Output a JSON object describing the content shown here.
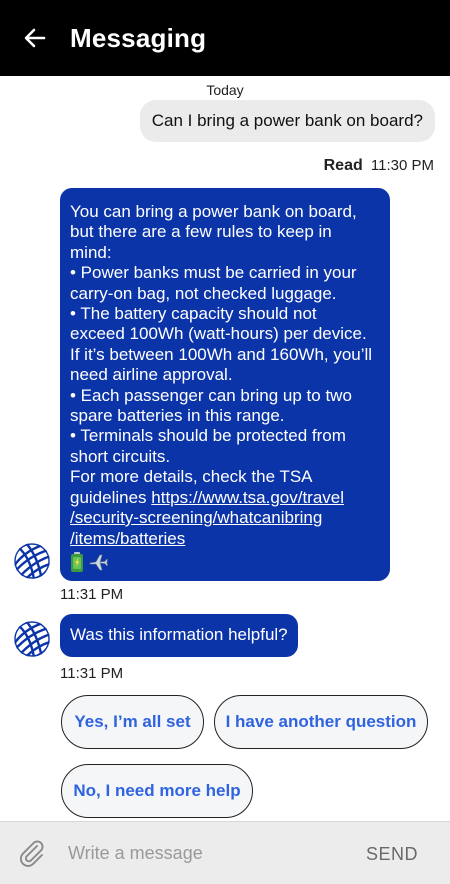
{
  "header": {
    "title": "Messaging",
    "back_icon": "arrow-left-icon"
  },
  "conversation": {
    "date_label": "Today",
    "user_message": "Can I bring a power bank on board?",
    "read_status": "Read",
    "read_time": "11:30 PM",
    "bot_answer": {
      "lines": [
        "You can bring a power bank on board,",
        "but there are a few rules to keep in",
        "mind:",
        "• Power banks must be carried in your",
        "carry-on bag, not checked luggage.",
        "• The battery capacity should not",
        "exceed 100Wh (watt-hours) per device.",
        "If it’s between 100Wh and 160Wh, you’ll",
        "need airline approval.",
        "• Each passenger can bring up to two",
        "spare batteries in this range.",
        "• Terminals should be protected from",
        "short circuits.",
        "For more details, check the TSA"
      ],
      "link_prefix": "guidelines ",
      "link_lines": [
        "https://www.tsa.gov/travel",
        "/security-screening/whatcanibring",
        "/items/batteries"
      ],
      "emojis": [
        "battery-icon",
        "airplane-icon"
      ],
      "time": "11:31 PM"
    },
    "bot_question": {
      "text": "Was this information helpful?",
      "time": "11:31 PM"
    },
    "quick_replies": [
      "Yes, I’m all set",
      "I have another question",
      "No, I need more help"
    ]
  },
  "composer": {
    "placeholder": "Write a message",
    "send_label": "SEND",
    "attach_icon": "paperclip-icon"
  },
  "colors": {
    "header_bg": "#000000",
    "bot_bubble": "#0b34a8",
    "user_bubble": "#ebebeb",
    "chip_text": "#2f63e0",
    "composer_bg": "#ececec"
  }
}
